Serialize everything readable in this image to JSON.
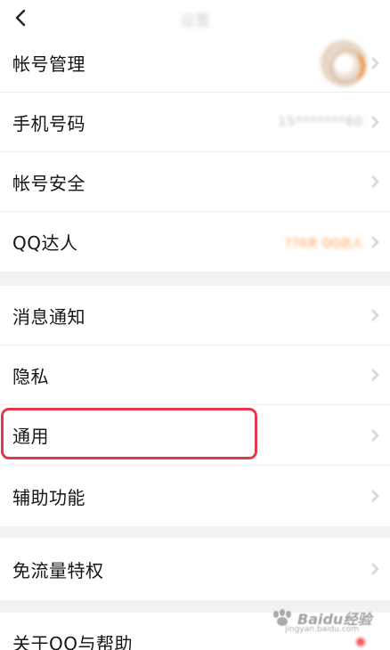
{
  "header": {
    "title": "设置",
    "back_icon": "back-arrow-icon"
  },
  "groups": [
    {
      "items": [
        {
          "label": "帐号管理",
          "right": "avatar"
        },
        {
          "label": "手机号码",
          "right_text": "15*******60"
        },
        {
          "label": "帐号安全"
        },
        {
          "label": "QQ达人",
          "right_text": "770天 QQ达人"
        }
      ]
    },
    {
      "items": [
        {
          "label": "消息通知"
        },
        {
          "label": "隐私"
        },
        {
          "label": "通用"
        },
        {
          "label": "辅助功能"
        }
      ]
    },
    {
      "items": [
        {
          "label": "免流量特权"
        }
      ]
    },
    {
      "items": [
        {
          "label": "关于QQ与帮助"
        }
      ]
    }
  ],
  "highlight": {
    "target": "通用",
    "color": "#e23a4b"
  },
  "watermark": {
    "brand": "Baidu经验",
    "url": "jingyan.baidu.com"
  },
  "colors": {
    "background": "#f2f2f5",
    "accent_orange": "#ff9a4a"
  }
}
